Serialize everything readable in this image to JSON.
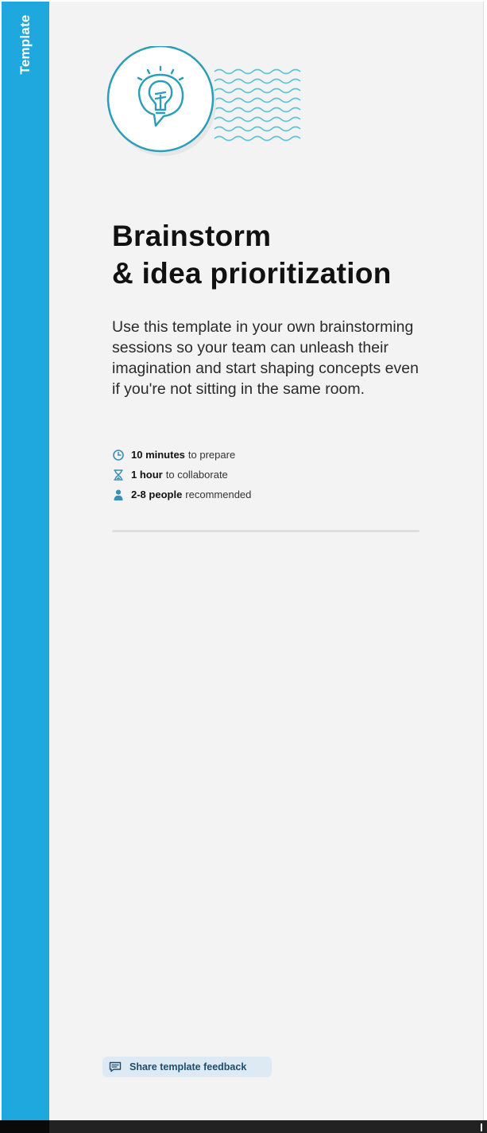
{
  "side_tab": {
    "label": "Template"
  },
  "illustration": {
    "icon": "lightbulb-speech-bubble-icon",
    "decoration": "wavy-lines"
  },
  "title": {
    "line1": "Brainstorm",
    "line2": "& idea prioritization"
  },
  "description": "Use this template in your own brainstorming sessions so your team can unleash their imagination and start shaping concepts even if you're not sitting in the same room.",
  "meta": [
    {
      "icon": "clock-icon",
      "strong": "10 minutes",
      "rest": "to prepare"
    },
    {
      "icon": "hourglass-icon",
      "strong": "1 hour",
      "rest": "to collaborate"
    },
    {
      "icon": "person-icon",
      "strong": "2-8 people",
      "rest": "recommended"
    }
  ],
  "feedback_button": {
    "icon": "comment-icon",
    "label": "Share template feedback"
  },
  "colors": {
    "accent": "#1ea8de",
    "panel_background": "#f3f3f3",
    "illustration_stroke": "#2a9db8",
    "meta_icon": "#3b8fb3",
    "feedback_button_background": "#ddeaf4",
    "feedback_button_text": "#1d4c6c"
  }
}
